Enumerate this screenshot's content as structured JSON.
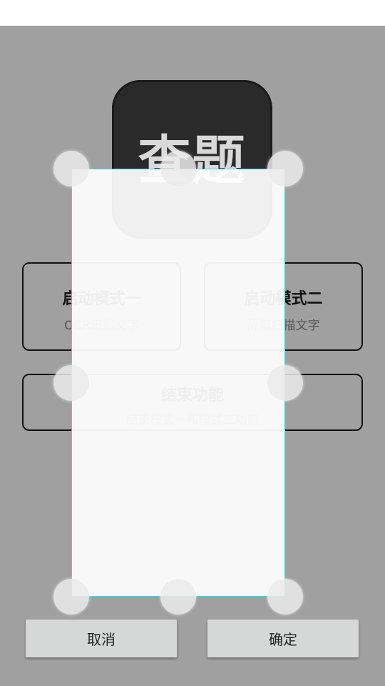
{
  "logo": {
    "text": "查题"
  },
  "mode_one": {
    "title": "启动模式一",
    "subtitle": "OCR识别文字"
  },
  "mode_two": {
    "title": "启动模式二",
    "subtitle": "屏幕扫描文字"
  },
  "end_function": {
    "title": "结束功能",
    "subtitle": "结束模式一和模式二功能"
  },
  "actions": {
    "cancel": "取消",
    "confirm": "确定"
  }
}
